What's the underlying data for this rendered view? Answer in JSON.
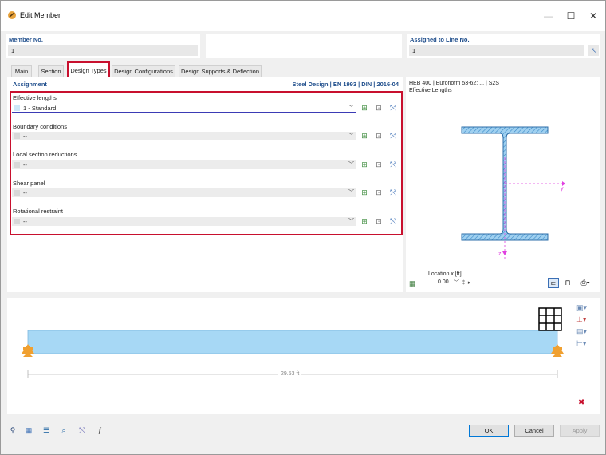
{
  "window": {
    "title": "Edit Member"
  },
  "header": {
    "member_no_label": "Member No.",
    "member_no_value": "1",
    "line_no_label": "Assigned to Line No.",
    "line_no_value": "1"
  },
  "tabs": [
    "Main",
    "Section",
    "Design Types",
    "Design Configurations",
    "Design Supports & Deflection"
  ],
  "assignment": {
    "title": "Assignment",
    "standard": "Steel Design | EN 1993 | DIN | 2016-04",
    "rows": [
      {
        "label": "Effective lengths",
        "value": "1 - Standard"
      },
      {
        "label": "Boundary conditions",
        "value": "--"
      },
      {
        "label": "Local section reductions",
        "value": "--"
      },
      {
        "label": "Shear panel",
        "value": "--"
      },
      {
        "label": "Rotational restraint",
        "value": "--"
      }
    ]
  },
  "preview": {
    "section_title": "HEB 400 | Euronorm 53-62; ... | S2S",
    "subtitle": "Effective Lengths",
    "axis_y": "y",
    "axis_z": "z",
    "location_label": "Location x [ft]",
    "location_value": "0.00"
  },
  "beam": {
    "length_label": "29.53 ft"
  },
  "buttons": {
    "ok": "OK",
    "cancel": "Cancel",
    "apply": "Apply"
  },
  "colors": {
    "accent_red": "#c8102e",
    "beam_blue": "#a7d8f5",
    "support_orange": "#f0a030",
    "section_blue": "#7fbfe8"
  }
}
